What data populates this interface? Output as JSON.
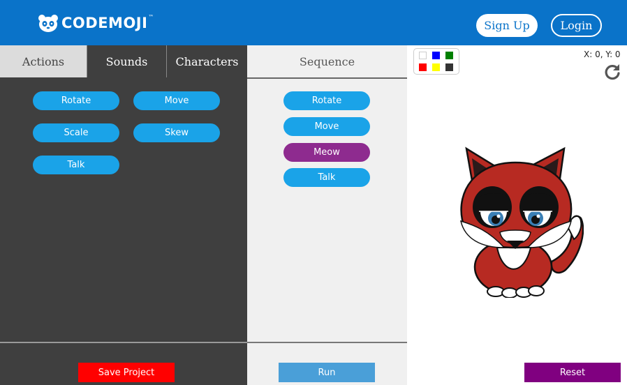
{
  "header": {
    "brand": "CODEMOJI",
    "brand_tm": "™",
    "signup_label": "Sign Up",
    "login_label": "Login",
    "color": "#0a73c9"
  },
  "tabs": [
    {
      "label": "Actions",
      "active": true
    },
    {
      "label": "Sounds",
      "active": false
    },
    {
      "label": "Characters",
      "active": false
    }
  ],
  "sequence": {
    "title": "Sequence",
    "items": [
      {
        "label": "Rotate",
        "kind": "action"
      },
      {
        "label": "Move",
        "kind": "action"
      },
      {
        "label": "Meow",
        "kind": "sound"
      },
      {
        "label": "Talk",
        "kind": "action"
      }
    ]
  },
  "actions": [
    "Rotate",
    "Move",
    "Scale",
    "Skew",
    "Talk"
  ],
  "buttons": {
    "save": "Save Project",
    "run": "Run",
    "reset": "Reset"
  },
  "stage": {
    "coords": "X: 0, Y: 0",
    "palette_colors": [
      "#ffffff",
      "#0000ff",
      "#008000",
      "#ff0000",
      "#ffff00",
      "#333333"
    ],
    "character": "fox"
  },
  "colors": {
    "action_pill": "#1aa3e8",
    "sound_pill": "#8e2b8f",
    "save": "#ff0000",
    "run": "#4a9fd8",
    "reset": "#800080"
  }
}
